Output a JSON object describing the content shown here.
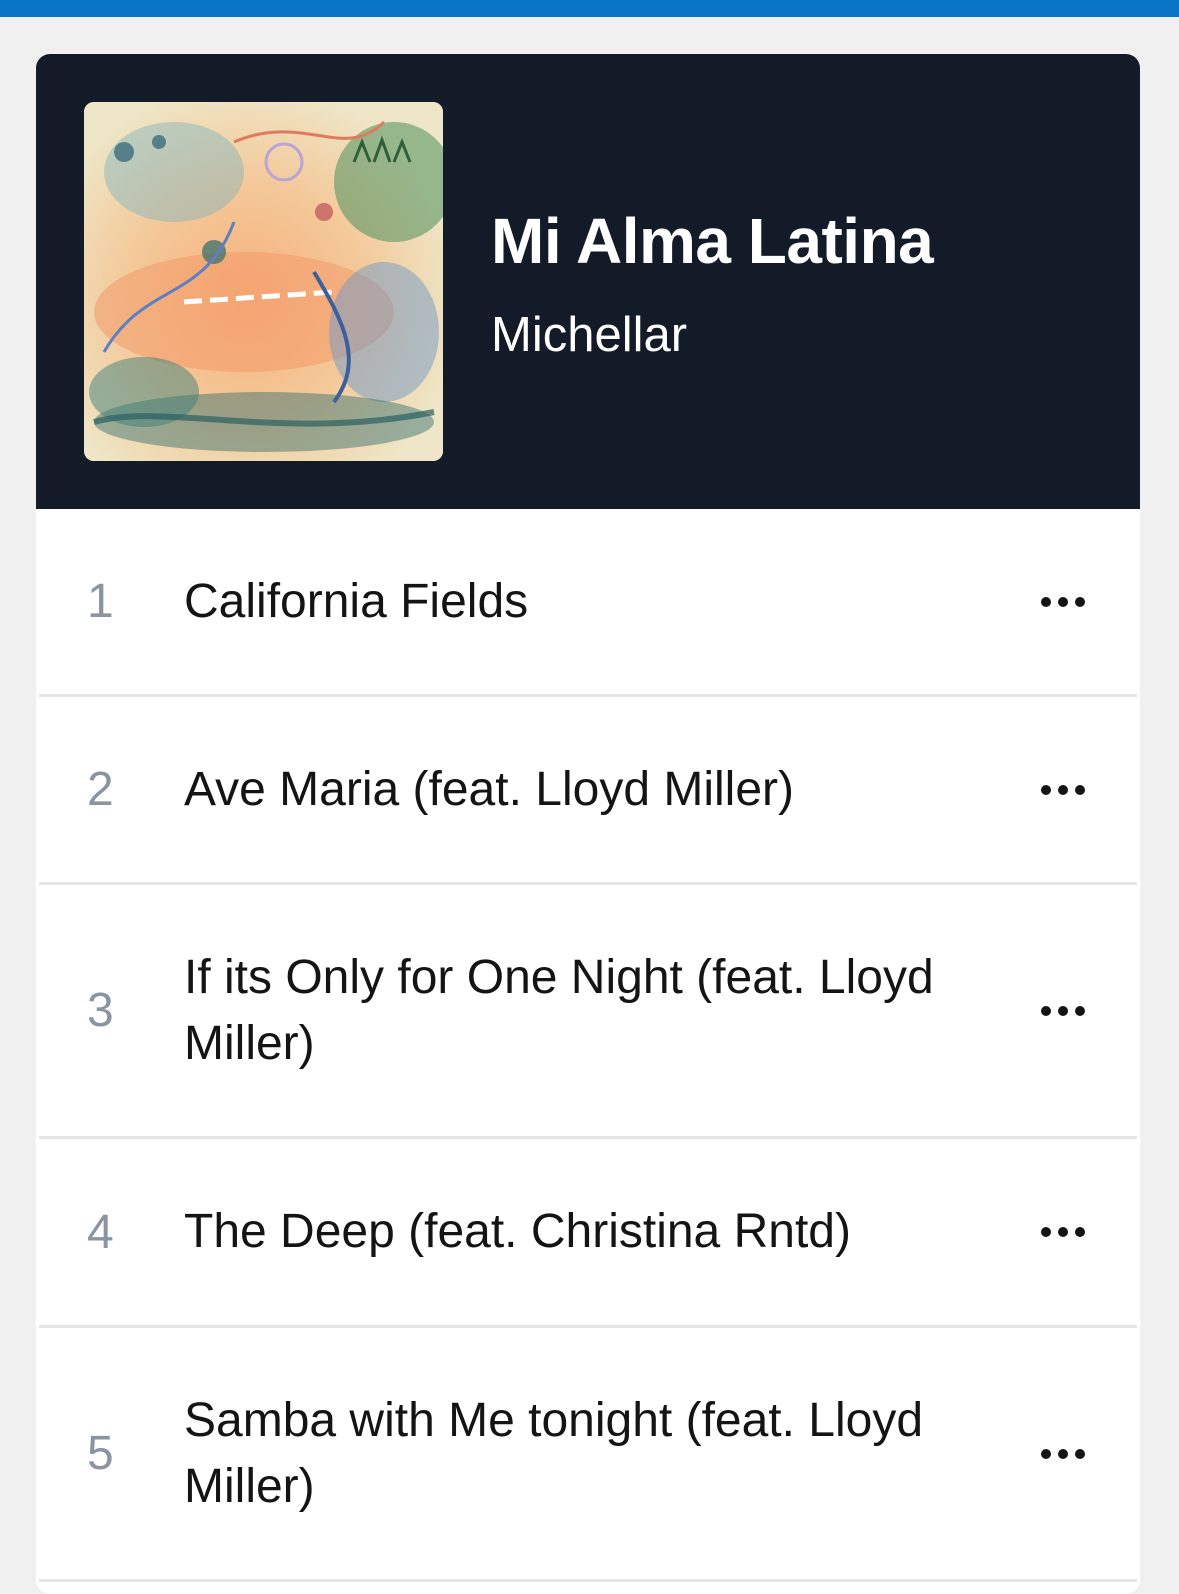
{
  "album": {
    "title": "Mi Alma Latina",
    "artist": "Michellar"
  },
  "tracks": [
    {
      "number": "1",
      "title": "California Fields"
    },
    {
      "number": "2",
      "title": "Ave Maria (feat. Lloyd Miller)"
    },
    {
      "number": "3",
      "title": "If its Only for One Night (feat. Lloyd Miller)"
    },
    {
      "number": "4",
      "title": "The Deep (feat. Christina Rntd)"
    },
    {
      "number": "5",
      "title": "Samba with Me tonight (feat. Lloyd Miller)"
    }
  ],
  "icons": {
    "more": "more-horizontal-icon"
  },
  "colors": {
    "top_bar": "#0a74c7",
    "header_bg": "#131a28",
    "track_number": "#8a94a2"
  }
}
